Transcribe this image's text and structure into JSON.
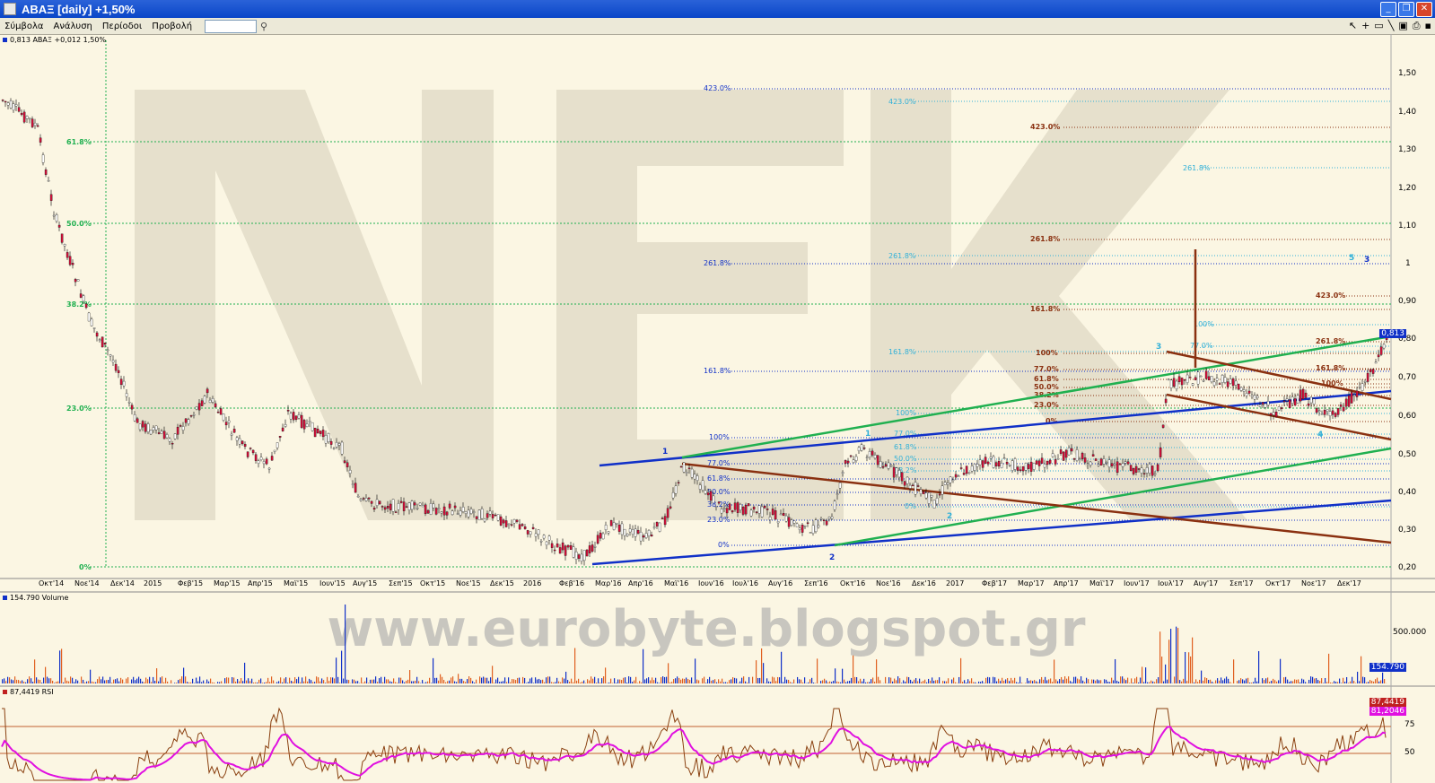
{
  "window": {
    "title": "ΑΒΑΞ [daily] +1,50%"
  },
  "menu": {
    "items": [
      "Σύμβολα",
      "Ανάλυση",
      "Περίοδοι",
      "Προβολή"
    ]
  },
  "price_panel": {
    "label": "0,813 ΑΒΑΞ +0,012 1,50%",
    "current_badge": "0,813",
    "y_ticks": [
      "1,50",
      "1,40",
      "1,30",
      "1,20",
      "1,10",
      "1",
      "0,90",
      "0,80",
      "0,70",
      "0,60",
      "0,50",
      "0,40",
      "0,30",
      "0,20"
    ],
    "x_ticks": [
      "Οκτ'14",
      "Νοε'14",
      "Δεκ'14",
      "2015",
      "Φεβ'15",
      "Μαρ'15",
      "Απρ'15",
      "Μαϊ'15",
      "Ιουν'15",
      "Αυγ'15",
      "Σεπ'15",
      "Οκτ'15",
      "Νοε'15",
      "Δεκ'15",
      "2016",
      "Φεβ'16",
      "Μαρ'16",
      "Απρ'16",
      "Μαϊ'16",
      "Ιουν'16",
      "Ιουλ'16",
      "Αυγ'16",
      "Σεπ'16",
      "Οκτ'16",
      "Νοε'16",
      "Δεκ'16",
      "2017",
      "Φεβ'17",
      "Μαρ'17",
      "Απρ'17",
      "Μαϊ'17",
      "Ιουν'17",
      "Ιουλ'17",
      "Αυγ'17",
      "Σεπ'17",
      "Οκτ'17",
      "Νοε'17",
      "Δεκ'17"
    ],
    "fib_left": [
      "61.8%",
      "50.0%",
      "38.2%",
      "23.0%",
      "0%"
    ],
    "fib_blue": [
      "423.0%",
      "261.8%",
      "161.8%",
      "100%",
      "77.0%",
      "61.8%",
      "50.0%",
      "38.2%",
      "23.0%",
      "0%"
    ],
    "fib_cyan": [
      "423.0%",
      "261.8%",
      "261.8%",
      "161.8%",
      "100%",
      "77.0%",
      "61.8%",
      "50.0%",
      "38.2%",
      "0%",
      "100%",
      "77.0%"
    ],
    "fib_brown": [
      "423.0%",
      "261.8%",
      "161.8%",
      "100%",
      "77.0%",
      "61.8%",
      "50.0%",
      "38.2%",
      "23.0%",
      "0%",
      "423.0%",
      "261.8%",
      "161.8%",
      "100%"
    ],
    "wave_labels": [
      "1",
      "2",
      "1",
      "2",
      "3",
      "3",
      "4",
      "5",
      "3"
    ]
  },
  "volume_panel": {
    "label": "154.790 Volume",
    "tick": "500.000",
    "badge": "154.790"
  },
  "rsi_panel": {
    "label": "87,4419 RSI",
    "ticks": [
      "75",
      "50"
    ],
    "badge1": "87,4419",
    "badge2": "81,2046"
  },
  "watermark": {
    "big": "NEK",
    "url": "www.eurobyte.blogspot.gr"
  },
  "colors": {
    "bg": "#fbf6e3",
    "up": "#ffffff",
    "down": "#d0103a",
    "blue_trend": "#1030c8",
    "green_trend": "#20b050",
    "brown_trend": "#8a3010",
    "rsi": "#e010e0",
    "titlebar": "#0a46c8"
  },
  "icons": [
    "pointer-icon",
    "crosshair-icon",
    "rectangle-icon",
    "line-tool-icon",
    "window-icon",
    "print-icon",
    "save-icon"
  ]
}
